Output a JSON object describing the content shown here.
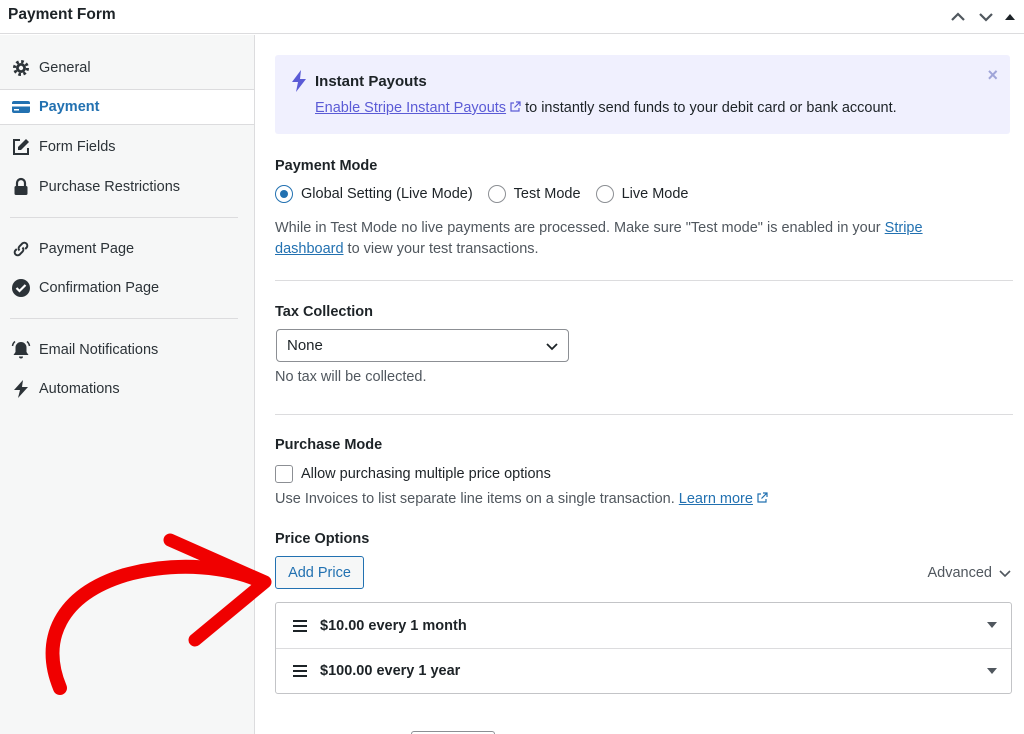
{
  "window": {
    "title": "Payment Form"
  },
  "sidebar": {
    "items": [
      {
        "label": "General",
        "icon": "gear-icon"
      },
      {
        "label": "Payment",
        "icon": "credit-card-icon",
        "active": true
      },
      {
        "label": "Form Fields",
        "icon": "edit-icon"
      },
      {
        "label": "Purchase Restrictions",
        "icon": "lock-icon"
      },
      {
        "label": "Payment Page",
        "icon": "link-icon"
      },
      {
        "label": "Confirmation Page",
        "icon": "check-circle-icon"
      },
      {
        "label": "Email Notifications",
        "icon": "bell-icon"
      },
      {
        "label": "Automations",
        "icon": "bolt-icon"
      }
    ]
  },
  "notice": {
    "title": "Instant Payouts",
    "link_text": "Enable Stripe Instant Payouts",
    "text_after": "to instantly send funds to your debit card or bank account.",
    "close_label": "×"
  },
  "payment_mode": {
    "label": "Payment Mode",
    "options": [
      {
        "label": "Global Setting (Live Mode)",
        "selected": true
      },
      {
        "label": "Test Mode",
        "selected": false
      },
      {
        "label": "Live Mode",
        "selected": false
      }
    ],
    "help_before": "While in Test Mode no live payments are processed. Make sure \"Test mode\" is enabled in your ",
    "help_link_1": "Stripe",
    "help_link_2": "dashboard",
    "help_after": " to view your test transactions."
  },
  "tax": {
    "label": "Tax Collection",
    "selected": "None",
    "help": "No tax will be collected."
  },
  "purchase_mode": {
    "label": "Purchase Mode",
    "checkbox_label": "Allow purchasing multiple price options",
    "checked": false,
    "help": "Use Invoices to list separate line items on a single transaction.",
    "learn_more": "Learn more"
  },
  "price_options": {
    "label": "Price Options",
    "add_button": "Add Price",
    "advanced": "Advanced",
    "prices": [
      {
        "label": "$10.00 every 1 month"
      },
      {
        "label": "$100.00 every 1 year"
      }
    ]
  },
  "colors": {
    "accent": "#2271b1",
    "notice_bg": "#f0f0fe",
    "annotation_arrow": "#f00000"
  }
}
